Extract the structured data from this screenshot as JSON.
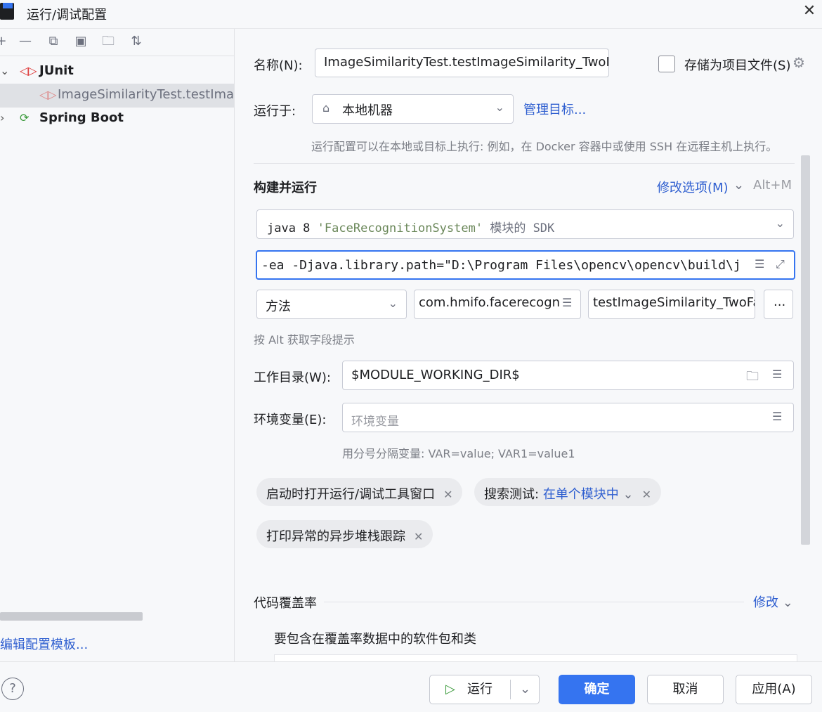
{
  "title": "运行/调试配置",
  "tree": {
    "junit": "JUnit",
    "test_item": "ImageSimilarityTest.testImag",
    "spring": "Spring Boot"
  },
  "edit_templates": "编辑配置模板...",
  "form": {
    "name_label": "名称(N):",
    "name_value": "ImageSimilarityTest.testImageSimilarity_TwoFa",
    "store_label": "存储为项目文件(S)",
    "run_on_label": "运行于:",
    "run_on_value": "本地机器",
    "manage_targets": "管理目标...",
    "run_on_hint": "运行配置可以在本地或目标上执行: 例如，在 Docker 容器中或使用 SSH 在远程主机上执行。",
    "build_run": "构建并运行",
    "modify_options": "修改选项(M)",
    "modify_shortcut": "Alt+M",
    "sdk_prefix": "java 8",
    "sdk_module": "'FaceRecognitionSystem'",
    "sdk_suffix": "模块的 SDK",
    "vm_options": "-ea -Djava.library.path=\"D:\\Program Files\\opencv\\opencv\\build\\j",
    "test_kind": "方法",
    "class_value": "com.hmifo.facerecogni",
    "method_value": "testImageSimilarity_TwoFa",
    "more": "...",
    "alt_hint": "按 Alt 获取字段提示",
    "workdir_label": "工作目录(W):",
    "workdir_value": "$MODULE_WORKING_DIR$",
    "env_label": "环境变量(E):",
    "env_placeholder": "环境变量",
    "env_hint": "用分号分隔变量: VAR=value; VAR1=value1",
    "chip1": "启动时打开运行/调试工具窗口",
    "chip2_prefix": "搜索测试:",
    "chip2_value": "在单个模块中",
    "chip3": "打印异常的异步堆栈跟踪",
    "coverage": "代码覆盖率",
    "coverage_modify": "修改",
    "coverage_include": "要包含在覆盖率数据中的软件包和类"
  },
  "buttons": {
    "help": "?",
    "run": "运行",
    "ok": "确定",
    "cancel": "取消",
    "apply": "应用(A)"
  }
}
